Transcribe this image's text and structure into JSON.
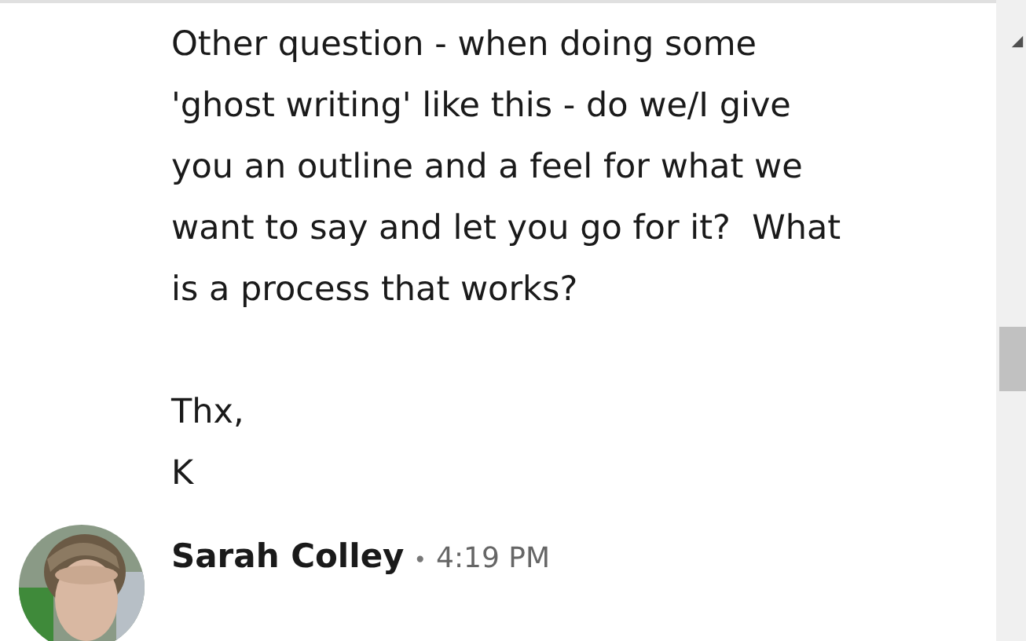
{
  "message": {
    "paragraphs": [
      {
        "lines": [
          "Other question - when doing some",
          "'ghost writing' like this - do we/I give",
          "you an outline and a feel for what we",
          "want to say and let you go for it?  What",
          "is a process that works?"
        ]
      },
      {
        "lines": [
          "Thx,",
          "K"
        ]
      }
    ]
  },
  "next_message": {
    "sender": "Sarah Colley",
    "separator": "•",
    "time": "4:19 PM"
  }
}
